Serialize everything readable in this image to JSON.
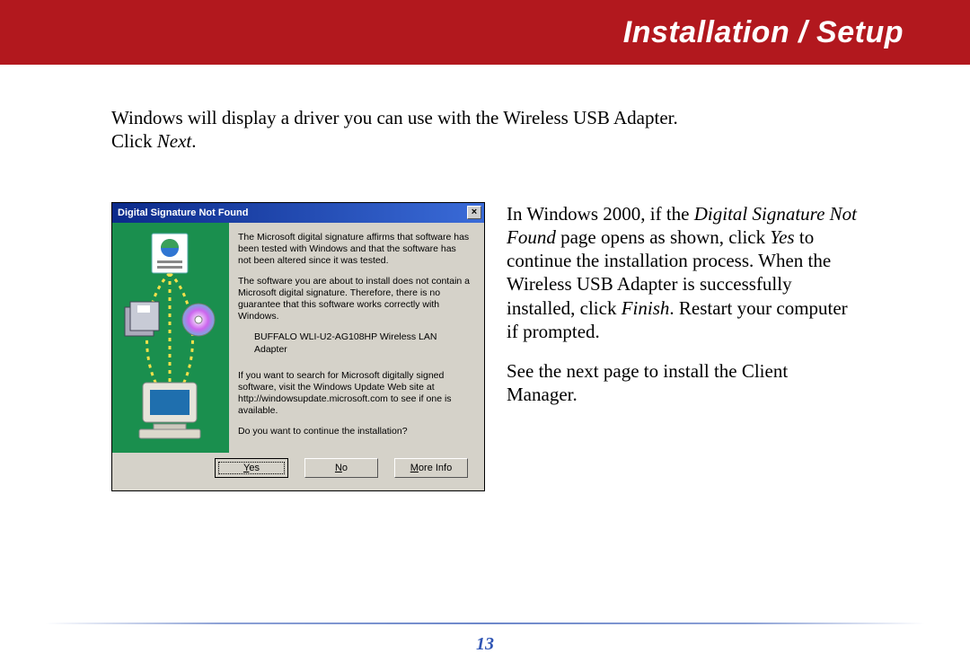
{
  "header": {
    "title": "Installation / Setup"
  },
  "intro": {
    "line1": "Windows will display a driver you can use with the Wireless USB Adapter.",
    "line2_pre": "Click ",
    "line2_em": "Next",
    "line2_post": "."
  },
  "dialog": {
    "title": "Digital Signature Not Found",
    "close_glyph": "×",
    "p1": "The Microsoft digital signature affirms that software has been tested with Windows and that the software has not been altered since it was tested.",
    "p2": "The software you are about to install does not contain a Microsoft digital signature. Therefore, there is no guarantee that this software works correctly with Windows.",
    "device": "BUFFALO WLI-U2-AG108HP Wireless LAN Adapter",
    "p3": "If you want to search for Microsoft digitally signed software, visit the Windows Update Web site at http://windowsupdate.microsoft.com to see if one is available.",
    "p4": "Do you want to continue the installation?",
    "buttons": {
      "yes_u": "Y",
      "yes_rest": "es",
      "no_u": "N",
      "no_rest": "o",
      "more_u": "M",
      "more_rest": "ore Info"
    }
  },
  "right": {
    "p1_a": "In Windows 2000, if the ",
    "p1_em1": "Digital Signature Not Found",
    "p1_b": " page opens as shown, click ",
    "p1_em2": "Yes",
    "p1_c": " to continue the installation process. When the Wireless USB Adapter is successfully installed, click ",
    "p1_em3": "Finish",
    "p1_d": ". Restart your computer if prompted.",
    "p2": "See the next page to install the Client Manager."
  },
  "page_number": "13"
}
